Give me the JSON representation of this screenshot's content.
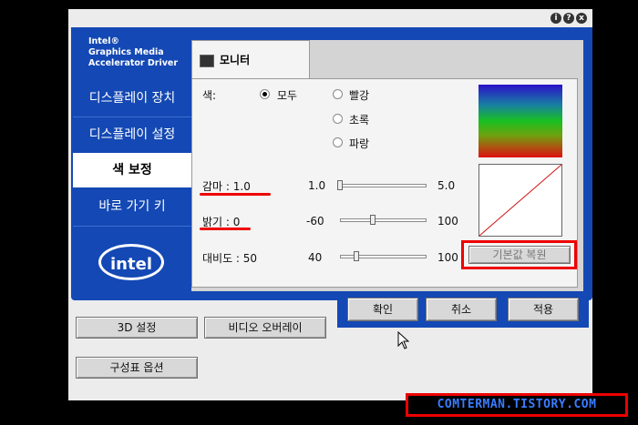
{
  "brand": {
    "lines": [
      "Intel®",
      "Graphics Media",
      "Accelerator Driver"
    ]
  },
  "title_buttons": [
    "i",
    "?",
    "x"
  ],
  "sidebar": {
    "items": [
      {
        "label": "디스플레이 장치"
      },
      {
        "label": "디스플레이 설정"
      },
      {
        "label": "색 보정"
      },
      {
        "label": "바로 가기 키"
      }
    ],
    "logo_text": "intel"
  },
  "tab": {
    "label": "모니터",
    "icon": "monitor-icon"
  },
  "color": {
    "label": "색:",
    "options": [
      "모두",
      "빨강",
      "초록",
      "파랑"
    ],
    "selected": "모두"
  },
  "sliders": {
    "gamma": {
      "label": "감마 : 1.0",
      "min": "1.0",
      "max": "5.0",
      "value": 1.0,
      "lo": 1.0,
      "hi": 5.0
    },
    "brightness": {
      "label": "밝기 : 0",
      "min": "-60",
      "max": "100",
      "value": 0,
      "lo": -60,
      "hi": 100
    },
    "contrast": {
      "label": "대비도 : 50",
      "min": "40",
      "max": "100",
      "value": 50,
      "lo": 40,
      "hi": 100
    }
  },
  "restore_button": "기본값 복원",
  "actions": {
    "ok": "확인",
    "cancel": "취소",
    "apply": "적용"
  },
  "bottom_buttons": {
    "three_d": "3D 설정",
    "video_overlay": "비디오 오버레이",
    "schemes": "구성표 옵션"
  },
  "watermark": "COMTERMAN.TISTORY.COM",
  "colors": {
    "accent": "#1448b4",
    "highlight": "#e00000"
  }
}
